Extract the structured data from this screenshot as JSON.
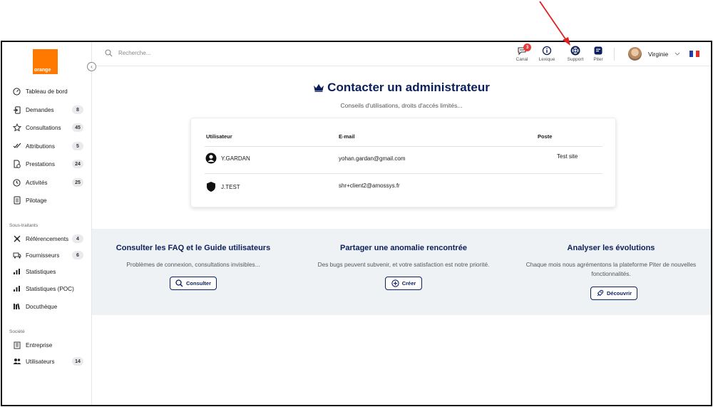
{
  "app": {
    "logo_text": "orange",
    "brand_color": "#ff7900",
    "accent": "#0b1f5c"
  },
  "search": {
    "placeholder": "Recherche..."
  },
  "topbar": {
    "items": [
      {
        "label": "Canal",
        "icon": "chat-icon",
        "badge": "3"
      },
      {
        "label": "Lexique",
        "icon": "info-icon"
      },
      {
        "label": "Support",
        "icon": "lifebuoy-icon"
      },
      {
        "label": "Piter",
        "icon": "piter-icon"
      }
    ],
    "user_name": "Virginie",
    "language_flag": "fr"
  },
  "sidebar": {
    "items": [
      {
        "label": "Tableau de bord",
        "icon": "dashboard-icon",
        "count": ""
      },
      {
        "label": "Demandes",
        "icon": "login-icon",
        "count": "8"
      },
      {
        "label": "Consultations",
        "icon": "star-icon",
        "count": "45"
      },
      {
        "label": "Attributions",
        "icon": "check-double-icon",
        "count": "5"
      },
      {
        "label": "Prestations",
        "icon": "document-clock-icon",
        "count": "24"
      },
      {
        "label": "Activités",
        "icon": "clock-icon",
        "count": "25"
      },
      {
        "label": "Pilotage",
        "icon": "clipboard-icon",
        "count": ""
      }
    ],
    "section_subcontractors": "Sous-traitants",
    "subcontractor_items": [
      {
        "label": "Référencements",
        "icon": "network-icon",
        "count": "4"
      },
      {
        "label": "Fournisseurs",
        "icon": "truck-icon",
        "count": "6"
      },
      {
        "label": "Statistiques",
        "icon": "chart-icon",
        "count": ""
      },
      {
        "label": "Statistiques (POC)",
        "icon": "chart-icon",
        "count": ""
      },
      {
        "label": "Docuthèque",
        "icon": "books-icon",
        "count": ""
      }
    ],
    "section_company": "Société",
    "company_items": [
      {
        "label": "Entreprise",
        "icon": "building-icon",
        "count": ""
      },
      {
        "label": "Utilisateurs",
        "icon": "users-icon",
        "count": "14"
      }
    ]
  },
  "main": {
    "title": "Contacter un administrateur",
    "subtitle": "Conseils d'utilisations, droits d'accès limités...",
    "table": {
      "headers": {
        "user": "Utilisateur",
        "email": "E-mail",
        "role": "Poste"
      },
      "rows": [
        {
          "user": "Y.GARDAN",
          "email": "yohan.gardan@gmail.com",
          "role": "Test site",
          "icon": "user-circle-icon"
        },
        {
          "user": "J.TEST",
          "email": "shr+client2@amossys.fr",
          "role": "",
          "icon": "shield-icon"
        }
      ]
    },
    "cards": [
      {
        "title": "Consulter les FAQ et le Guide utilisateurs",
        "text": "Problèmes de connexion, consultations invisibles...",
        "button": "Consulter",
        "icon": "search-icon"
      },
      {
        "title": "Partager une anomalie rencontrée",
        "text": "Des bugs peuvent subvenir, et votre satisfaction est notre priorité.",
        "button": "Créer",
        "icon": "plus-circle-icon"
      },
      {
        "title": "Analyser les évolutions",
        "text": "Chaque mois nous agrémentons la plateforme Piter de nouvelles fonctionnalités.",
        "button": "Découvrir",
        "icon": "rocket-icon"
      }
    ]
  }
}
